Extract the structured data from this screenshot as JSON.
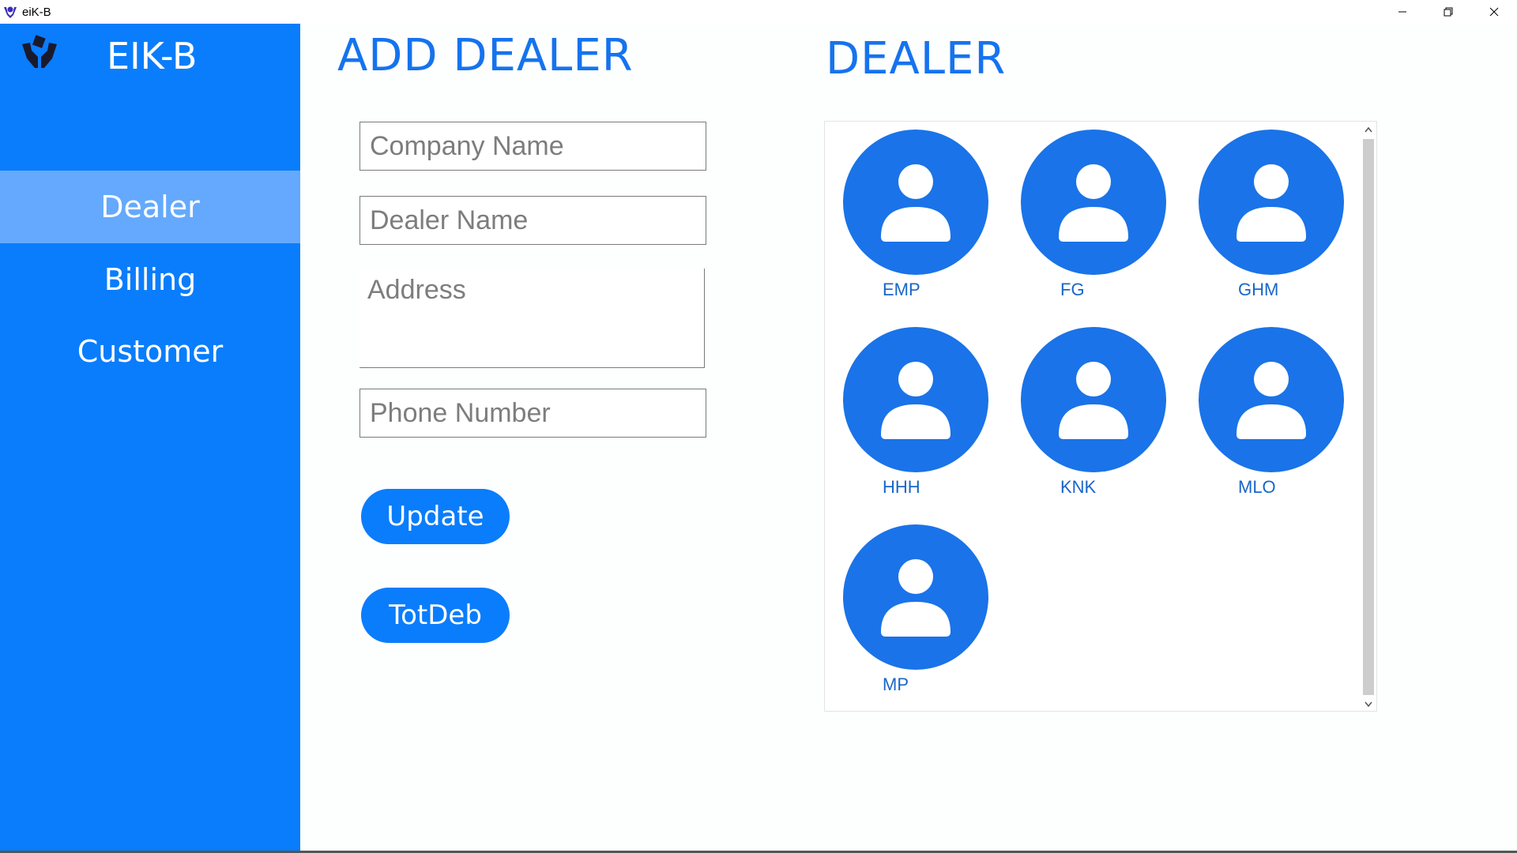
{
  "window": {
    "title": "eiK-B",
    "app_icon": "hands-logo-icon",
    "controls": [
      "minimize-icon",
      "restore-icon",
      "close-icon"
    ]
  },
  "sidebar": {
    "brand": "EIK-B",
    "logo_icon": "hands-holding-icon",
    "items": [
      {
        "label": "Dealer",
        "active": true
      },
      {
        "label": "Billing",
        "active": false
      },
      {
        "label": "Customer",
        "active": false
      }
    ]
  },
  "form": {
    "title": "ADD DEALER",
    "company_name": {
      "placeholder": "Company Name",
      "value": ""
    },
    "dealer_name": {
      "placeholder": "Dealer Name",
      "value": ""
    },
    "address": {
      "placeholder": "Address",
      "value": ""
    },
    "phone_number": {
      "placeholder": "Phone Number",
      "value": ""
    },
    "update_label": "Update",
    "totdeb_label": "TotDeb"
  },
  "dealers": {
    "title": "DEALER",
    "avatar_icon": "person-avatar-icon",
    "items": [
      {
        "name": "EMP"
      },
      {
        "name": "FG"
      },
      {
        "name": "GHM"
      },
      {
        "name": "HHH"
      },
      {
        "name": "KNK"
      },
      {
        "name": "MLO"
      },
      {
        "name": "MP"
      }
    ]
  },
  "colors": {
    "sidebar": "#0a7dfc",
    "sidebar_active": "#64a9fd",
    "accent": "#1573ee",
    "avatar": "#1a73e8"
  }
}
